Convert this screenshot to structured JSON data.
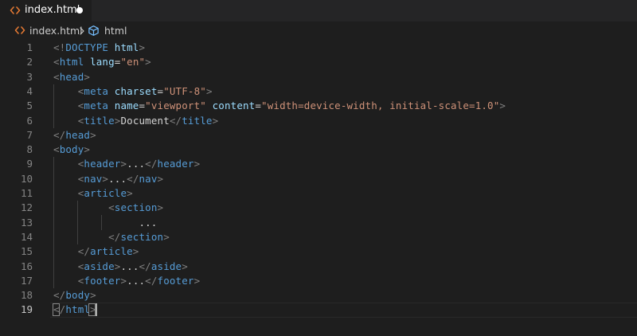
{
  "tab": {
    "label": "index.html",
    "icon": "html-file-icon",
    "dirty": true
  },
  "breadcrumb": {
    "file": "index.html",
    "separator_icon": "chevron-right-icon",
    "element_icon": "cube-icon",
    "element": "html"
  },
  "colors": {
    "background": "#1e1e1e",
    "tag": "#569cd6",
    "attribute": "#9cdcfe",
    "string": "#ce9178",
    "text": "#d4d4d4",
    "punctuation": "#808080",
    "line_number": "#858585",
    "file_icon": "#e37933"
  },
  "editor": {
    "current_line": 19,
    "lines": [
      {
        "n": "1",
        "tokens": [
          [
            "p",
            "<!"
          ],
          [
            "t",
            "DOCTYPE"
          ],
          [
            "x",
            " "
          ],
          [
            "a",
            "html"
          ],
          [
            "p",
            ">"
          ]
        ]
      },
      {
        "n": "2",
        "tokens": [
          [
            "p",
            "<"
          ],
          [
            "t",
            "html"
          ],
          [
            "x",
            " "
          ],
          [
            "a",
            "lang"
          ],
          [
            "x",
            "="
          ],
          [
            "s",
            "\"en\""
          ],
          [
            "p",
            ">"
          ]
        ]
      },
      {
        "n": "3",
        "tokens": [
          [
            "p",
            "<"
          ],
          [
            "t",
            "head"
          ],
          [
            "p",
            ">"
          ]
        ]
      },
      {
        "n": "4",
        "tokens": [
          [
            "x",
            "    "
          ],
          [
            "p",
            "<"
          ],
          [
            "t",
            "meta"
          ],
          [
            "x",
            " "
          ],
          [
            "a",
            "charset"
          ],
          [
            "x",
            "="
          ],
          [
            "s",
            "\"UTF-8\""
          ],
          [
            "p",
            ">"
          ]
        ]
      },
      {
        "n": "5",
        "tokens": [
          [
            "x",
            "    "
          ],
          [
            "p",
            "<"
          ],
          [
            "t",
            "meta"
          ],
          [
            "x",
            " "
          ],
          [
            "a",
            "name"
          ],
          [
            "x",
            "="
          ],
          [
            "s",
            "\"viewport\""
          ],
          [
            "x",
            " "
          ],
          [
            "a",
            "content"
          ],
          [
            "x",
            "="
          ],
          [
            "s",
            "\"width=device-width, initial-scale=1.0\""
          ],
          [
            "p",
            ">"
          ]
        ]
      },
      {
        "n": "6",
        "tokens": [
          [
            "x",
            "    "
          ],
          [
            "p",
            "<"
          ],
          [
            "t",
            "title"
          ],
          [
            "p",
            ">"
          ],
          [
            "x",
            "Document"
          ],
          [
            "p",
            "</"
          ],
          [
            "t",
            "title"
          ],
          [
            "p",
            ">"
          ]
        ]
      },
      {
        "n": "7",
        "tokens": [
          [
            "p",
            "</"
          ],
          [
            "t",
            "head"
          ],
          [
            "p",
            ">"
          ]
        ]
      },
      {
        "n": "8",
        "tokens": [
          [
            "p",
            "<"
          ],
          [
            "t",
            "body"
          ],
          [
            "p",
            ">"
          ]
        ]
      },
      {
        "n": "9",
        "tokens": [
          [
            "x",
            "    "
          ],
          [
            "p",
            "<"
          ],
          [
            "t",
            "header"
          ],
          [
            "p",
            ">"
          ],
          [
            "x",
            "..."
          ],
          [
            "p",
            "</"
          ],
          [
            "t",
            "header"
          ],
          [
            "p",
            ">"
          ]
        ]
      },
      {
        "n": "10",
        "tokens": [
          [
            "x",
            "    "
          ],
          [
            "p",
            "<"
          ],
          [
            "t",
            "nav"
          ],
          [
            "p",
            ">"
          ],
          [
            "x",
            "..."
          ],
          [
            "p",
            "</"
          ],
          [
            "t",
            "nav"
          ],
          [
            "p",
            ">"
          ]
        ]
      },
      {
        "n": "11",
        "tokens": [
          [
            "x",
            "    "
          ],
          [
            "p",
            "<"
          ],
          [
            "t",
            "article"
          ],
          [
            "p",
            ">"
          ]
        ]
      },
      {
        "n": "12",
        "tokens": [
          [
            "x",
            "         "
          ],
          [
            "p",
            "<"
          ],
          [
            "t",
            "section"
          ],
          [
            "p",
            ">"
          ]
        ]
      },
      {
        "n": "13",
        "tokens": [
          [
            "x",
            "              ..."
          ]
        ]
      },
      {
        "n": "14",
        "tokens": [
          [
            "x",
            "         "
          ],
          [
            "p",
            "</"
          ],
          [
            "t",
            "section"
          ],
          [
            "p",
            ">"
          ]
        ]
      },
      {
        "n": "15",
        "tokens": [
          [
            "x",
            "    "
          ],
          [
            "p",
            "</"
          ],
          [
            "t",
            "article"
          ],
          [
            "p",
            ">"
          ]
        ]
      },
      {
        "n": "16",
        "tokens": [
          [
            "x",
            "    "
          ],
          [
            "p",
            "<"
          ],
          [
            "t",
            "aside"
          ],
          [
            "p",
            ">"
          ],
          [
            "x",
            "..."
          ],
          [
            "p",
            "</"
          ],
          [
            "t",
            "aside"
          ],
          [
            "p",
            ">"
          ]
        ]
      },
      {
        "n": "17",
        "tokens": [
          [
            "x",
            "    "
          ],
          [
            "p",
            "<"
          ],
          [
            "t",
            "footer"
          ],
          [
            "p",
            ">"
          ],
          [
            "x",
            "..."
          ],
          [
            "p",
            "</"
          ],
          [
            "t",
            "footer"
          ],
          [
            "p",
            ">"
          ]
        ]
      },
      {
        "n": "18",
        "tokens": [
          [
            "p",
            "</"
          ],
          [
            "t",
            "body"
          ],
          [
            "p",
            ">"
          ]
        ]
      },
      {
        "n": "19",
        "tokens": [
          [
            "p",
            "</"
          ],
          [
            "t",
            "html"
          ],
          [
            "p",
            ">"
          ]
        ]
      }
    ]
  }
}
